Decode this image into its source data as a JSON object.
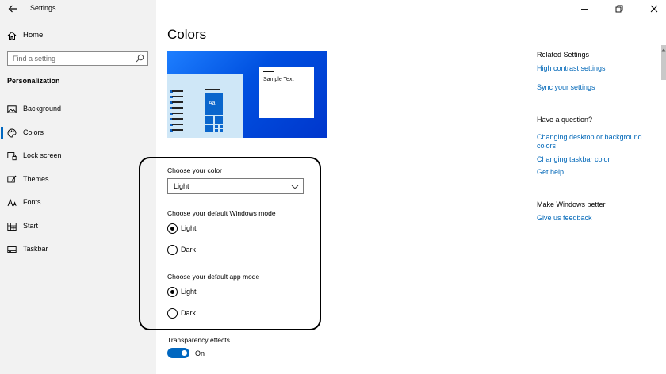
{
  "window": {
    "title": "Settings"
  },
  "sidebar": {
    "home_label": "Home",
    "search_placeholder": "Find a setting",
    "section_label": "Personalization",
    "items": [
      {
        "label": "Background",
        "icon": "image-icon"
      },
      {
        "label": "Colors",
        "icon": "palette-icon",
        "selected": true
      },
      {
        "label": "Lock screen",
        "icon": "lock-screen-icon"
      },
      {
        "label": "Themes",
        "icon": "brush-icon"
      },
      {
        "label": "Fonts",
        "icon": "font-icon"
      },
      {
        "label": "Start",
        "icon": "start-grid-icon"
      },
      {
        "label": "Taskbar",
        "icon": "taskbar-icon"
      }
    ]
  },
  "main": {
    "title": "Colors",
    "preview": {
      "sample_text": "Sample Text",
      "tile_text": "Aa"
    },
    "choose_color": {
      "label": "Choose your color",
      "value": "Light"
    },
    "windows_mode": {
      "label": "Choose your default Windows mode",
      "options": [
        "Light",
        "Dark"
      ],
      "selected": "Light"
    },
    "app_mode": {
      "label": "Choose your default app mode",
      "options": [
        "Light",
        "Dark"
      ],
      "selected": "Light"
    },
    "transparency": {
      "label": "Transparency effects",
      "state": "On"
    }
  },
  "right_panel": {
    "related_heading": "Related Settings",
    "related_links": [
      "High contrast settings",
      "Sync your settings"
    ],
    "question_heading": "Have a question?",
    "question_links": [
      "Changing desktop or background colors",
      "Changing taskbar color",
      "Get help"
    ],
    "better_heading": "Make Windows better",
    "better_links": [
      "Give us feedback"
    ]
  },
  "colors": {
    "accent": "#0067c0",
    "link": "#0067b8",
    "sidebar_bg": "#f2f2f2"
  }
}
